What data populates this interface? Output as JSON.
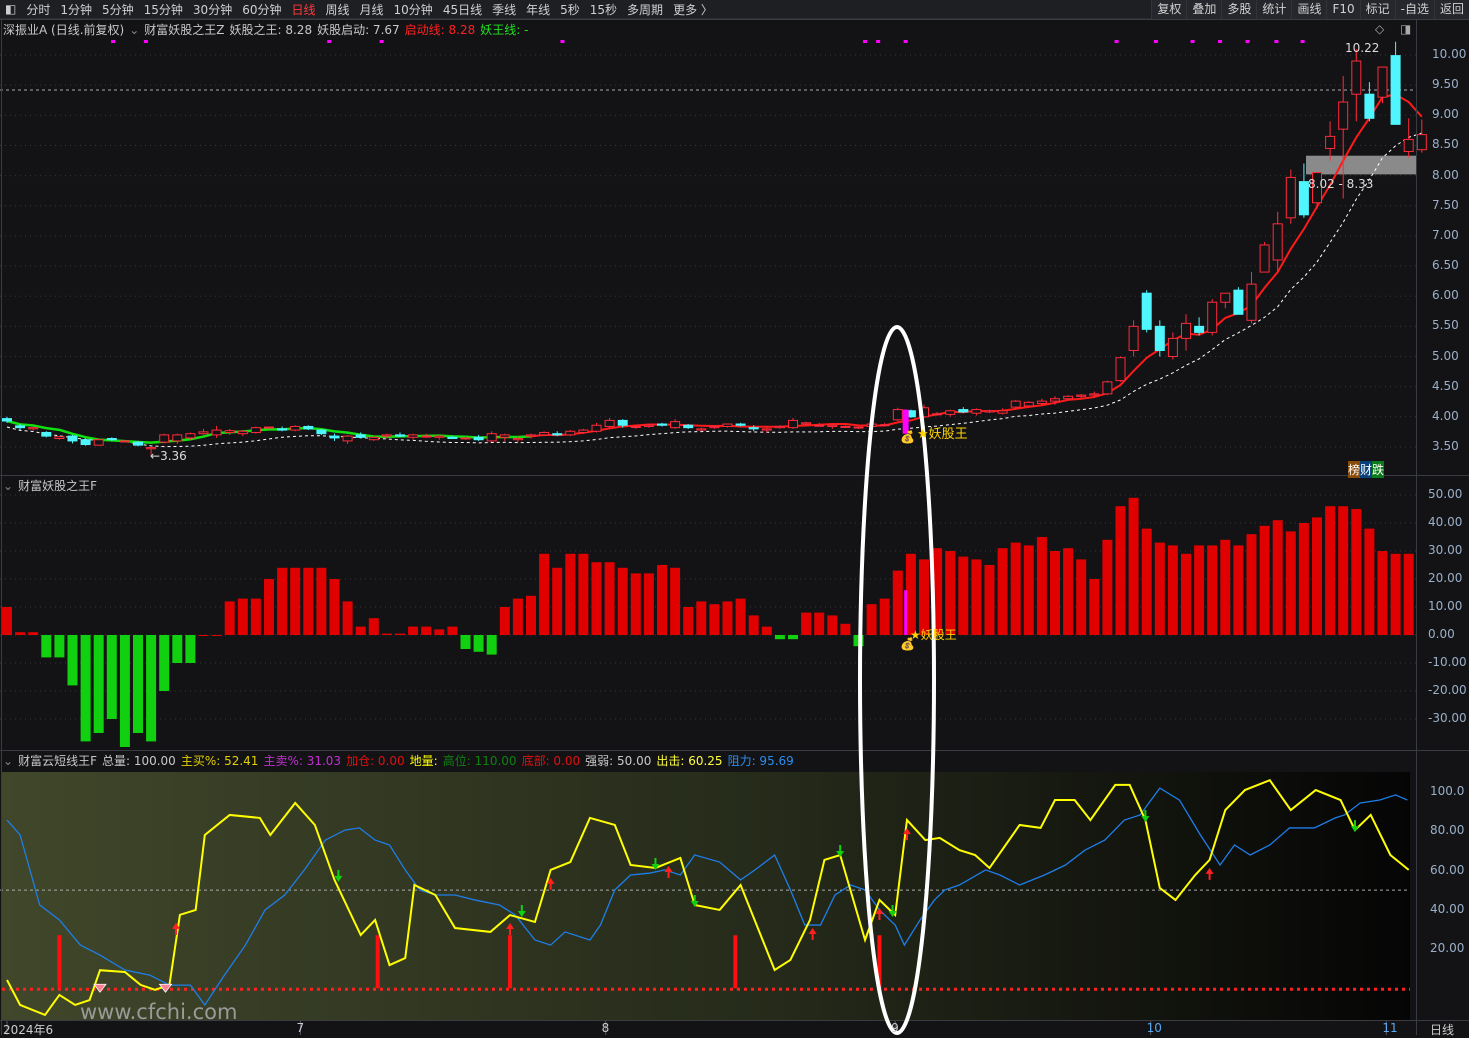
{
  "toolbar": {
    "left": [
      "分时",
      "1分钟",
      "5分钟",
      "15分钟",
      "30分钟",
      "60分钟",
      "日线",
      "周线",
      "月线",
      "10分钟",
      "45日线",
      "季线",
      "年线",
      "5秒",
      "15秒",
      "多周期",
      "更多 〉"
    ],
    "active": "日线",
    "right": [
      "复权",
      "叠加",
      "多股",
      "统计",
      "画线",
      "F10",
      "标记",
      "-自选",
      "返回"
    ]
  },
  "main_legend": {
    "stock": "深振业A (日线.前复权)",
    "indicator": "财富妖股之王Z",
    "yaogu_label": "妖股之王: 8.28",
    "qidong_label": "妖股启动: 7.67",
    "qidongxian_label": "启动线: 8.28",
    "yaowangxian_label": "妖王线: -"
  },
  "indicator_legend": {
    "name": "财富妖股之王F"
  },
  "bottom_legend": {
    "name": "财富云短线王F",
    "total": "总量: 100.00",
    "zhumai": "主买%: 52.41",
    "zhumai2": "主卖%: 31.03",
    "jiacang": "加仓: 0.00",
    "diliang": "地量:",
    "gaowei": "高位: 110.00",
    "dibu": "底部: 0.00",
    "qiangruo": "强弱: 50.00",
    "chuji": "出击: 60.25",
    "zuli": "阻力: 95.69"
  },
  "annotations": {
    "high": "10.22",
    "low": "3.36",
    "range": "8.02 - 8.33",
    "yaoguwang": "★妖股王",
    "yaoguwang2": "★妖股王",
    "badge": [
      "榜",
      "财",
      "跌"
    ],
    "watermark": "www.cfchi.com"
  },
  "price_axis": [
    "10.00",
    "9.50",
    "9.00",
    "8.50",
    "8.00",
    "7.50",
    "7.00",
    "6.50",
    "6.00",
    "5.50",
    "5.00",
    "4.50",
    "4.00",
    "3.50"
  ],
  "ind_axis": [
    "50.00",
    "40.00",
    "30.00",
    "20.00",
    "10.00",
    "0.00",
    "-10.00",
    "-20.00",
    "-30.00"
  ],
  "bot_axis": [
    "100.0",
    "80.00",
    "60.00",
    "40.00",
    "20.00"
  ],
  "x_axis": {
    "labels": [
      {
        "text": "2024年6",
        "i": 0
      },
      {
        "text": "7",
        "i": 22.4
      },
      {
        "text": "8",
        "i": 45.7
      },
      {
        "text": "9",
        "i": 67.8
      },
      {
        "text": "10",
        "i": 87.3
      },
      {
        "text": "11",
        "i": 105.3
      }
    ],
    "period": "日线"
  },
  "colors": {
    "up": "#ff2a3a",
    "down": "#4ff6ff",
    "ma": "#ff1a1a",
    "ma_green": "#10e010",
    "yellow": "#ffff00",
    "blue": "#1e7ee8",
    "magenta": "#ff00ff"
  },
  "chart_data": {
    "type": "candlestick",
    "ohlc": [
      [
        3.97,
        4.0,
        3.9,
        3.93
      ],
      [
        3.85,
        3.88,
        3.78,
        3.82
      ],
      [
        3.8,
        3.83,
        3.77,
        3.82
      ],
      [
        3.74,
        3.76,
        3.66,
        3.68
      ],
      [
        3.64,
        3.68,
        3.62,
        3.67
      ],
      [
        3.68,
        3.7,
        3.56,
        3.6
      ],
      [
        3.62,
        3.64,
        3.52,
        3.54
      ],
      [
        3.53,
        3.64,
        3.52,
        3.62
      ],
      [
        3.64,
        3.66,
        3.6,
        3.62
      ],
      [
        3.6,
        3.61,
        3.59,
        3.6
      ],
      [
        3.58,
        3.6,
        3.51,
        3.53
      ],
      [
        3.47,
        3.5,
        3.36,
        3.49
      ],
      [
        3.58,
        3.72,
        3.56,
        3.7
      ],
      [
        3.6,
        3.72,
        3.55,
        3.7
      ],
      [
        3.65,
        3.74,
        3.62,
        3.72
      ],
      [
        3.72,
        3.8,
        3.7,
        3.75
      ],
      [
        3.7,
        3.85,
        3.65,
        3.78
      ],
      [
        3.74,
        3.8,
        3.7,
        3.77
      ],
      [
        3.72,
        3.78,
        3.68,
        3.76
      ],
      [
        3.74,
        3.84,
        3.72,
        3.82
      ],
      [
        3.82,
        3.84,
        3.8,
        3.83
      ],
      [
        3.8,
        3.84,
        3.76,
        3.78
      ],
      [
        3.78,
        3.86,
        3.76,
        3.84
      ],
      [
        3.84,
        3.86,
        3.78,
        3.8
      ],
      [
        3.78,
        3.8,
        3.7,
        3.72
      ],
      [
        3.68,
        3.72,
        3.6,
        3.65
      ],
      [
        3.6,
        3.7,
        3.55,
        3.68
      ],
      [
        3.7,
        3.74,
        3.64,
        3.66
      ],
      [
        3.62,
        3.68,
        3.6,
        3.66
      ],
      [
        3.68,
        3.72,
        3.64,
        3.7
      ],
      [
        3.7,
        3.74,
        3.66,
        3.68
      ],
      [
        3.66,
        3.72,
        3.62,
        3.7
      ],
      [
        3.68,
        3.72,
        3.65,
        3.68
      ],
      [
        3.66,
        3.7,
        3.62,
        3.68
      ],
      [
        3.66,
        3.68,
        3.63,
        3.64
      ],
      [
        3.64,
        3.68,
        3.62,
        3.65
      ],
      [
        3.66,
        3.7,
        3.6,
        3.62
      ],
      [
        3.6,
        3.76,
        3.58,
        3.72
      ],
      [
        3.66,
        3.72,
        3.6,
        3.7
      ],
      [
        3.62,
        3.68,
        3.58,
        3.64
      ],
      [
        3.68,
        3.72,
        3.64,
        3.7
      ],
      [
        3.7,
        3.76,
        3.68,
        3.74
      ],
      [
        3.72,
        3.76,
        3.68,
        3.7
      ],
      [
        3.7,
        3.78,
        3.68,
        3.76
      ],
      [
        3.74,
        3.8,
        3.72,
        3.78
      ],
      [
        3.76,
        3.9,
        3.74,
        3.86
      ],
      [
        3.84,
        3.98,
        3.8,
        3.94
      ],
      [
        3.94,
        3.96,
        3.82,
        3.86
      ],
      [
        3.84,
        3.86,
        3.8,
        3.84
      ],
      [
        3.84,
        3.88,
        3.82,
        3.86
      ],
      [
        3.88,
        3.9,
        3.84,
        3.86
      ],
      [
        3.82,
        3.96,
        3.8,
        3.92
      ],
      [
        3.86,
        3.88,
        3.8,
        3.82
      ],
      [
        3.78,
        3.82,
        3.76,
        3.8
      ],
      [
        3.82,
        3.86,
        3.8,
        3.84
      ],
      [
        3.84,
        3.88,
        3.82,
        3.88
      ],
      [
        3.88,
        3.9,
        3.84,
        3.86
      ],
      [
        3.82,
        3.86,
        3.76,
        3.8
      ],
      [
        3.78,
        3.82,
        3.74,
        3.8
      ],
      [
        3.82,
        3.86,
        3.8,
        3.84
      ],
      [
        3.82,
        3.98,
        3.8,
        3.94
      ],
      [
        3.88,
        3.92,
        3.84,
        3.9
      ],
      [
        3.86,
        3.9,
        3.84,
        3.86
      ],
      [
        3.84,
        3.88,
        3.8,
        3.86
      ],
      [
        3.84,
        3.86,
        3.82,
        3.84
      ],
      [
        3.82,
        3.84,
        3.8,
        3.83
      ],
      [
        3.84,
        3.9,
        3.82,
        3.88
      ],
      [
        3.86,
        3.9,
        3.84,
        3.87
      ],
      [
        3.95,
        4.15,
        3.93,
        4.12
      ],
      [
        4.1,
        4.12,
        3.98,
        4.0
      ],
      [
        4.0,
        4.2,
        3.98,
        4.15
      ],
      [
        4.05,
        4.08,
        4.02,
        4.05
      ],
      [
        4.04,
        4.12,
        4.0,
        4.1
      ],
      [
        4.12,
        4.16,
        4.06,
        4.08
      ],
      [
        4.06,
        4.14,
        4.02,
        4.12
      ],
      [
        4.08,
        4.12,
        4.06,
        4.1
      ],
      [
        4.06,
        4.14,
        4.04,
        4.1
      ],
      [
        4.16,
        4.28,
        4.14,
        4.26
      ],
      [
        4.18,
        4.26,
        4.16,
        4.24
      ],
      [
        4.22,
        4.3,
        4.2,
        4.26
      ],
      [
        4.26,
        4.34,
        4.2,
        4.3
      ],
      [
        4.3,
        4.36,
        4.28,
        4.34
      ],
      [
        4.34,
        4.38,
        4.3,
        4.36
      ],
      [
        4.36,
        4.42,
        4.32,
        4.38
      ],
      [
        4.38,
        4.6,
        4.36,
        4.58
      ],
      [
        4.6,
        5.0,
        4.58,
        4.98
      ],
      [
        5.1,
        5.6,
        5.0,
        5.5
      ],
      [
        6.05,
        6.1,
        5.4,
        5.45
      ],
      [
        5.5,
        5.6,
        5.0,
        5.1
      ],
      [
        5.0,
        5.4,
        4.95,
        5.3
      ],
      [
        5.3,
        5.7,
        5.1,
        5.55
      ],
      [
        5.5,
        5.65,
        5.35,
        5.4
      ],
      [
        5.4,
        5.95,
        5.35,
        5.9
      ],
      [
        5.9,
        6.05,
        5.8,
        6.05
      ],
      [
        6.1,
        6.15,
        5.7,
        5.7
      ],
      [
        5.6,
        6.4,
        5.55,
        6.2
      ],
      [
        6.4,
        6.9,
        6.4,
        6.85
      ],
      [
        6.6,
        7.4,
        6.4,
        7.2
      ],
      [
        7.3,
        8.1,
        7.2,
        7.97
      ],
      [
        7.9,
        8.2,
        7.3,
        7.35
      ],
      [
        7.55,
        8.05,
        7.45,
        8.05
      ],
      [
        8.45,
        8.9,
        8.25,
        8.65
      ],
      [
        8.77,
        9.65,
        7.62,
        9.22
      ],
      [
        9.35,
        10.1,
        8.9,
        9.9
      ],
      [
        9.35,
        9.55,
        8.9,
        8.95
      ],
      [
        9.3,
        9.8,
        9.2,
        9.8
      ],
      [
        9.99,
        10.22,
        8.85,
        8.85
      ],
      [
        8.4,
        8.95,
        8.3,
        8.6
      ],
      [
        8.43,
        8.93,
        8.38,
        8.68
      ]
    ],
    "ma_green_until": 40,
    "indicator_bars": [
      10,
      1,
      1,
      -8,
      -8,
      -18,
      -38,
      -35,
      -30,
      -40,
      -35,
      -38,
      -20,
      -10,
      -10,
      0,
      0,
      12,
      13,
      13,
      20,
      24,
      24,
      24,
      24,
      20,
      12,
      3,
      6,
      0.5,
      0.5,
      3,
      3,
      2,
      3,
      -5,
      -6,
      -7,
      10,
      13,
      14,
      29,
      24,
      29,
      29,
      26,
      26,
      24,
      22,
      22,
      25,
      24,
      10,
      12,
      11,
      12,
      13,
      7,
      3,
      -1.5,
      -1.5,
      8,
      8,
      7,
      4,
      -4,
      11,
      13,
      23,
      29,
      27,
      31,
      30,
      28,
      27,
      25,
      31,
      33,
      32,
      35,
      30,
      31,
      27,
      20,
      34,
      46,
      49,
      38,
      33,
      32,
      29,
      32,
      32,
      34,
      32,
      36,
      39,
      41,
      37,
      40,
      42,
      46,
      46,
      45,
      38,
      30,
      29,
      29
    ],
    "yellow": [
      [
        0,
        4.2
      ],
      [
        1,
        -8.5
      ],
      [
        2.9,
        -13.6
      ],
      [
        4,
        -3.4
      ],
      [
        5.2,
        -8.5
      ],
      [
        6.3,
        -6
      ],
      [
        7.1,
        9.2
      ],
      [
        9,
        8.3
      ],
      [
        10.2,
        1.7
      ],
      [
        11.3,
        -0.8
      ],
      [
        12.4,
        1.7
      ],
      [
        13.2,
        37.4
      ],
      [
        14.4,
        39.9
      ],
      [
        15.1,
        78.1
      ],
      [
        17,
        88.3
      ],
      [
        19.3,
        86.8
      ],
      [
        20.1,
        78.1
      ],
      [
        22,
        94.4
      ],
      [
        23.5,
        83.2
      ],
      [
        25,
        55.2
      ],
      [
        27,
        27.1
      ],
      [
        28.1,
        34.8
      ],
      [
        29.2,
        11.8
      ],
      [
        30.4,
        15.4
      ],
      [
        31.1,
        52.6
      ],
      [
        32.7,
        47.5
      ],
      [
        34.2,
        30.7
      ],
      [
        36.9,
        28.7
      ],
      [
        38.4,
        37.3
      ],
      [
        40.3,
        33.8
      ],
      [
        41.5,
        60.3
      ],
      [
        43,
        64.3
      ],
      [
        44.5,
        86.8
      ],
      [
        46.4,
        83.2
      ],
      [
        47.6,
        62.8
      ],
      [
        49.5,
        61.3
      ],
      [
        51.4,
        66.4
      ],
      [
        52.5,
        42.4
      ],
      [
        54.4,
        39.9
      ],
      [
        56,
        52.6
      ],
      [
        58.6,
        9.3
      ],
      [
        59.8,
        14.4
      ],
      [
        61.3,
        34.8
      ],
      [
        62.4,
        65.4
      ],
      [
        63.6,
        67.9
      ],
      [
        65.5,
        24.6
      ],
      [
        66.6,
        45
      ],
      [
        67.8,
        37.3
      ],
      [
        68.7,
        85.7
      ],
      [
        70.1,
        75.5
      ],
      [
        71.2,
        76.6
      ],
      [
        72.7,
        70.4
      ],
      [
        73.9,
        67.9
      ],
      [
        75,
        61.3
      ],
      [
        77.3,
        83.2
      ],
      [
        78.9,
        81.7
      ],
      [
        80,
        95.9
      ],
      [
        81.5,
        95.9
      ],
      [
        82.7,
        85.7
      ],
      [
        84.6,
        103.6
      ],
      [
        85.7,
        103.6
      ],
      [
        86.9,
        85.7
      ],
      [
        88,
        51.1
      ],
      [
        89.2,
        45
      ],
      [
        90.7,
        57.7
      ],
      [
        91.8,
        65.4
      ],
      [
        93,
        90.8
      ],
      [
        94.5,
        101
      ],
      [
        96.4,
        106
      ],
      [
        98,
        90.8
      ],
      [
        99.9,
        101
      ],
      [
        101.8,
        95.9
      ],
      [
        102.9,
        80.6
      ],
      [
        104.1,
        88.3
      ],
      [
        105.6,
        67.9
      ],
      [
        107,
        60.3
      ]
    ],
    "blue": [
      [
        0,
        85.7
      ],
      [
        1,
        78.1
      ],
      [
        2.5,
        42.4
      ],
      [
        4,
        34.8
      ],
      [
        5.6,
        22
      ],
      [
        7.1,
        16.9
      ],
      [
        9,
        9.3
      ],
      [
        10.9,
        6.7
      ],
      [
        12.4,
        1.6
      ],
      [
        14,
        1.6
      ],
      [
        15.1,
        -8.5
      ],
      [
        16.6,
        6.7
      ],
      [
        18.2,
        22
      ],
      [
        19.7,
        39.9
      ],
      [
        21.2,
        47.5
      ],
      [
        22.7,
        60.3
      ],
      [
        24.3,
        75.5
      ],
      [
        25.8,
        80.6
      ],
      [
        26.9,
        81.7
      ],
      [
        28.1,
        75.5
      ],
      [
        29.2,
        73
      ],
      [
        30.4,
        60.3
      ],
      [
        31.5,
        50.1
      ],
      [
        32.7,
        47.5
      ],
      [
        34.2,
        47.5
      ],
      [
        35.7,
        45
      ],
      [
        37.6,
        42.4
      ],
      [
        38.8,
        37.3
      ],
      [
        40.3,
        24.6
      ],
      [
        41.5,
        22
      ],
      [
        42.6,
        28.7
      ],
      [
        44.5,
        24.6
      ],
      [
        45.3,
        32.2
      ],
      [
        46.4,
        50.1
      ],
      [
        47.6,
        57.7
      ],
      [
        49.1,
        58.7
      ],
      [
        50.2,
        60.3
      ],
      [
        51.4,
        57.7
      ],
      [
        52.5,
        67.9
      ],
      [
        54.4,
        64.3
      ],
      [
        56,
        55.2
      ],
      [
        57.1,
        60.3
      ],
      [
        58.6,
        67.9
      ],
      [
        59.8,
        50.1
      ],
      [
        60.9,
        32.2
      ],
      [
        62.1,
        32.2
      ],
      [
        63.2,
        47.5
      ],
      [
        64.4,
        52.6
      ],
      [
        65.5,
        50.1
      ],
      [
        66.6,
        39.9
      ],
      [
        67.8,
        32.2
      ],
      [
        68.5,
        22
      ],
      [
        69.7,
        34.8
      ],
      [
        70.8,
        45
      ],
      [
        71.6,
        50.1
      ],
      [
        72.7,
        52.6
      ],
      [
        74.7,
        60.3
      ],
      [
        75.8,
        57.7
      ],
      [
        77.3,
        52.6
      ],
      [
        79.2,
        57.7
      ],
      [
        80.8,
        62.8
      ],
      [
        82.3,
        70.4
      ],
      [
        83.8,
        75.5
      ],
      [
        85.3,
        85.7
      ],
      [
        86.5,
        88.3
      ],
      [
        88,
        102
      ],
      [
        89.5,
        95.9
      ],
      [
        91.1,
        78.1
      ],
      [
        92.6,
        62.8
      ],
      [
        93.7,
        73
      ],
      [
        94.9,
        67.9
      ],
      [
        96.4,
        73
      ],
      [
        97.9,
        81.7
      ],
      [
        99.8,
        81.7
      ],
      [
        101.4,
        86.8
      ],
      [
        102.1,
        88.3
      ],
      [
        103.3,
        94.4
      ],
      [
        104.8,
        95.9
      ],
      [
        106,
        98.5
      ],
      [
        106.9,
        95.9
      ]
    ],
    "buy_arrows": [
      12.9,
      38.4,
      41.5,
      50.5,
      61.5,
      66.6,
      68.7,
      91.8
    ],
    "sell_arrows": [
      25.3,
      39.3,
      49.5,
      52.5,
      63.6,
      67.6,
      86.9,
      102.9
    ],
    "red_bars": [
      4,
      28.3,
      38.4,
      55.6,
      66.6
    ],
    "diamonds": [
      7.1,
      12.1
    ],
    "top_dots": [
      8.1,
      10.6,
      24.6,
      28.6,
      42.4,
      65.5,
      66.5,
      68.6,
      84.7,
      87.7,
      90.5,
      92.6,
      94.7,
      96.9,
      98.9
    ],
    "dashed_price": 9.42,
    "range_box": [
      8.02,
      8.33
    ]
  }
}
